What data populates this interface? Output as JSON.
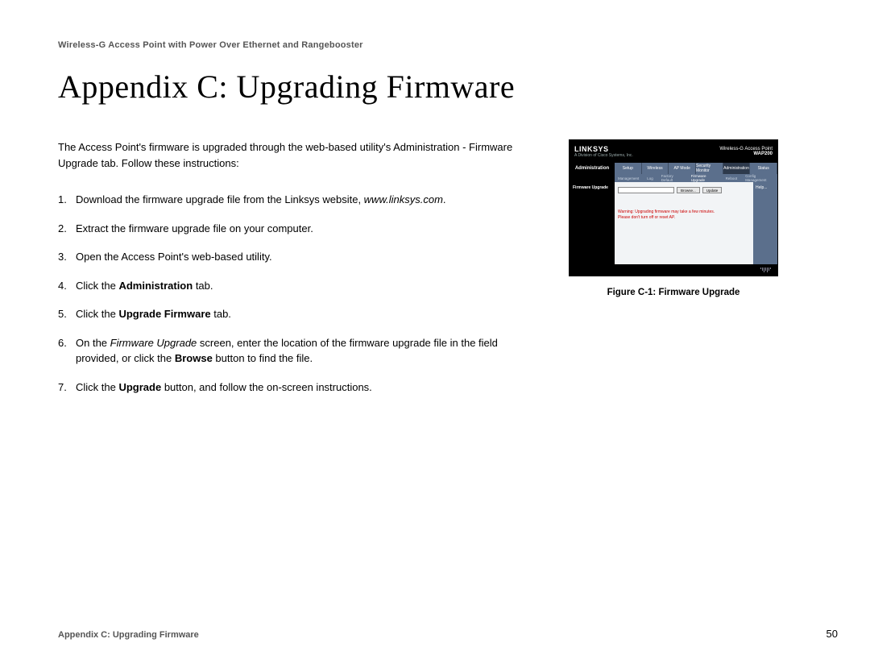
{
  "header": "Wireless-G Access Point with Power Over Ethernet and Rangebooster",
  "title": "Appendix C: Upgrading Firmware",
  "intro": "The Access Point's firmware is upgraded through the web-based utility's Administration - Firmware Upgrade tab. Follow these instructions:",
  "steps": {
    "s1_a": "Download the firmware upgrade file from the Linksys website, ",
    "s1_b": "www.linksys.com",
    "s1_c": ".",
    "s2": "Extract the firmware upgrade file on your computer.",
    "s3": "Open the Access Point's web-based utility.",
    "s4_a": "Click the ",
    "s4_b": "Administration",
    "s4_c": " tab.",
    "s5_a": "Click the ",
    "s5_b": "Upgrade Firmware",
    "s5_c": " tab.",
    "s6_a": "On the ",
    "s6_b": "Firmware Upgrade",
    "s6_c": " screen, enter the location of the firmware upgrade file in the field provided, or click the ",
    "s6_d": "Browse",
    "s6_e": " button to find the file.",
    "s7_a": "Click the ",
    "s7_b": "Upgrade",
    "s7_c": " button, and follow the on-screen instructions."
  },
  "figure": {
    "caption": "Figure C-1: Firmware Upgrade",
    "logo": "LINKSYS",
    "logo_sub": "A Division of Cisco Systems, Inc.",
    "product": "Wireless-G Access Point",
    "model": "WAP200",
    "side_label": "Administration",
    "body_label": "Firmware Upgrade",
    "tabs": [
      "Setup",
      "Wireless",
      "AP Mode",
      "Security Monitor",
      "Administration",
      "Status"
    ],
    "subtabs": [
      "Management",
      "Log",
      "Factory Default",
      "Firmware Upgrade",
      "Reboot",
      "Config Management"
    ],
    "browse": "Browse...",
    "update": "Update",
    "warn1": "Warning: Upgrading firmware may take a few minutes.",
    "warn2": "Please don't turn off or reset AP.",
    "help": "Help..."
  },
  "footer": {
    "left": "Appendix C: Upgrading Firmware",
    "page": "50"
  }
}
